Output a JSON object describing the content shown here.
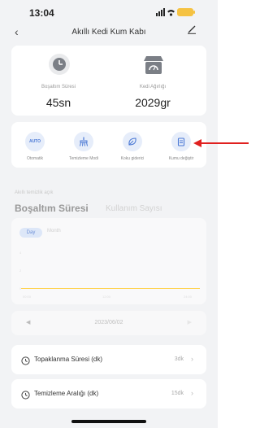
{
  "status": {
    "time": "13:04",
    "signal": "│││ ◠"
  },
  "header": {
    "back": "‹",
    "title": "Akıllı Kedi Kum Kabı",
    "edit": "∕"
  },
  "stats": [
    {
      "label": "Boşaltım Süresi",
      "value": "45sn"
    },
    {
      "label": "Kedi Ağırlığı",
      "value": "2029gr"
    }
  ],
  "modes": [
    {
      "label": "Otomatik",
      "icon": "auto-icon",
      "glyph": "AUTO"
    },
    {
      "label": "Temizleme Modi",
      "icon": "cleaning-icon"
    },
    {
      "label": "Koku giderici",
      "icon": "leaf-icon"
    },
    {
      "label": "Kumu değiştir",
      "icon": "trash-icon"
    }
  ],
  "smart_text": "Akıllı temizlik açık",
  "tabs": {
    "active": "Boşaltım Süresi",
    "inactive": "Kullanım Sayısı"
  },
  "chart": {
    "segment_day": "Day",
    "segment_month": "Month",
    "y_ticks": [
      "4",
      "2",
      "0"
    ],
    "x_ticks": [
      "00:00",
      "12:00",
      "24:00"
    ],
    "line_color": "#ffd24a"
  },
  "date": {
    "prev": "◀",
    "value": "2023/06/02",
    "next": "▶"
  },
  "settings": [
    {
      "label": "Topaklanma Süresi (dk)",
      "value": "3dk",
      "chevron": "›"
    },
    {
      "label": "Temizleme Aralığı (dk)",
      "value": "15dk",
      "chevron": "›"
    }
  ],
  "accent_color": "#e0201f"
}
